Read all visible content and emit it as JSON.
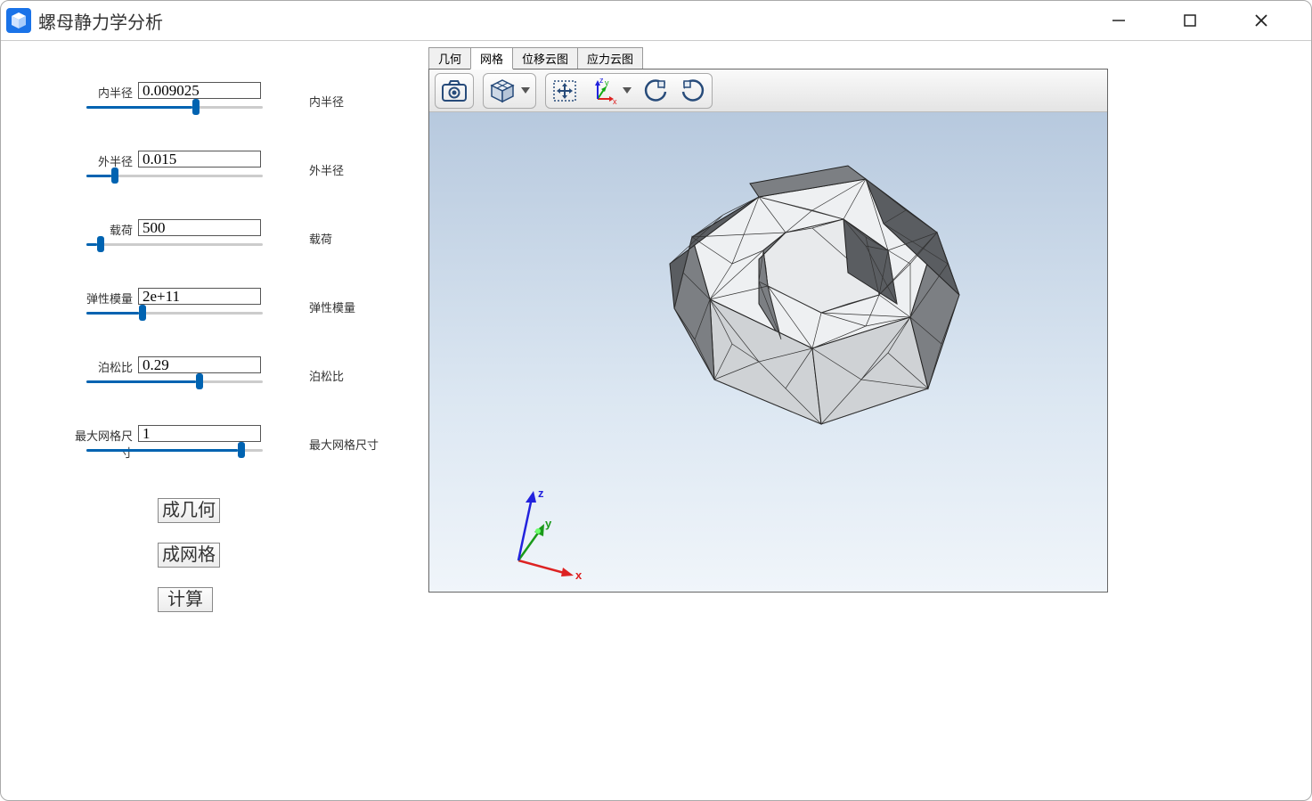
{
  "title": "螺母静力学分析",
  "params": [
    {
      "leftLabel": "内半径",
      "value": "0.009025",
      "rightLabel": "内半径",
      "sliderPct": 60
    },
    {
      "leftLabel": "外半径",
      "value": "0.015",
      "rightLabel": "外半径",
      "sliderPct": 14
    },
    {
      "leftLabel": "载荷",
      "value": "500",
      "rightLabel": "载荷",
      "sliderPct": 6
    },
    {
      "leftLabel": "弹性模量",
      "value": "2e+11",
      "rightLabel": "弹性模量",
      "sliderPct": 30
    },
    {
      "leftLabel": "泊松比",
      "value": "0.29",
      "rightLabel": "泊松比",
      "sliderPct": 62
    },
    {
      "leftLabel": "最大网格尺寸",
      "value": "1",
      "rightLabel": "最大网格尺寸",
      "sliderPct": 86
    }
  ],
  "buttons": {
    "genGeom": "成几何",
    "genMesh": "成网格",
    "compute": "计算"
  },
  "tabs": {
    "geom": "几何",
    "mesh": "网格",
    "disp": "位移云图",
    "stress": "应力云图",
    "active": "mesh"
  },
  "axes": {
    "x": "x",
    "y": "y",
    "z": "z"
  }
}
